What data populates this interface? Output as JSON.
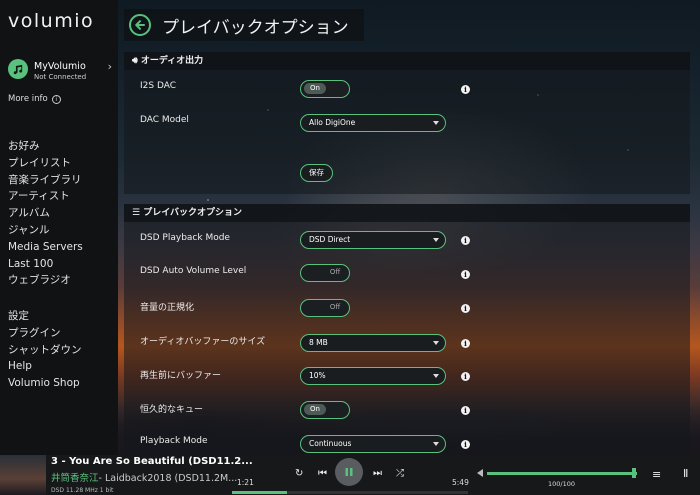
{
  "brand": {
    "logo": "volumio",
    "accent": "#59c17d"
  },
  "myvolumio": {
    "name": "MyVolumio",
    "status": "Not Connected",
    "more_info": "More info"
  },
  "sidebar": {
    "items": [
      "お好み",
      "プレイリスト",
      "音楽ライブラリ",
      "アーティスト",
      "アルバム",
      "ジャンル",
      "Media Servers",
      "Last 100",
      "ウェブラジオ"
    ],
    "items2": [
      "設定",
      "プラグイン",
      "シャットダウン",
      "Help",
      "Volumio Shop"
    ]
  },
  "header": {
    "title": "プレイバックオプション"
  },
  "audio_output": {
    "title": "オーディオ出力",
    "i2s_label": "I2S DAC",
    "i2s_state": "On",
    "dac_label": "DAC Model",
    "dac_value": "Allo DigiOne",
    "save_label": "保存"
  },
  "playback": {
    "title": "プレイバックオプション",
    "rows": {
      "dsd_mode": {
        "label": "DSD Playback Mode",
        "value": "DSD Direct"
      },
      "dsd_auto": {
        "label": "DSD Auto Volume Level",
        "value": "Off"
      },
      "normalize": {
        "label": "音量の正規化",
        "value": "Off"
      },
      "buffer": {
        "label": "オーディオバッファーのサイズ",
        "value": "8 MB"
      },
      "prebuffer": {
        "label": "再生前にバッファー",
        "value": "10%"
      },
      "persistent": {
        "label": "恒久的なキュー",
        "value": "On"
      },
      "mode": {
        "label": "Playback Mode",
        "value": "Continuous"
      }
    }
  },
  "player": {
    "title": "3 - You Are So Beautiful (DSD11.2...",
    "artist": "井筒香奈江",
    "album": "- Laidback2018 (DSD11.2M...",
    "meta": "DSD 11.28 MHz 1 bit",
    "elapsed": "1:21",
    "total": "5:49",
    "seek_fraction": 0.232,
    "volume_text": "100/100",
    "volume_fraction": 1.0
  }
}
